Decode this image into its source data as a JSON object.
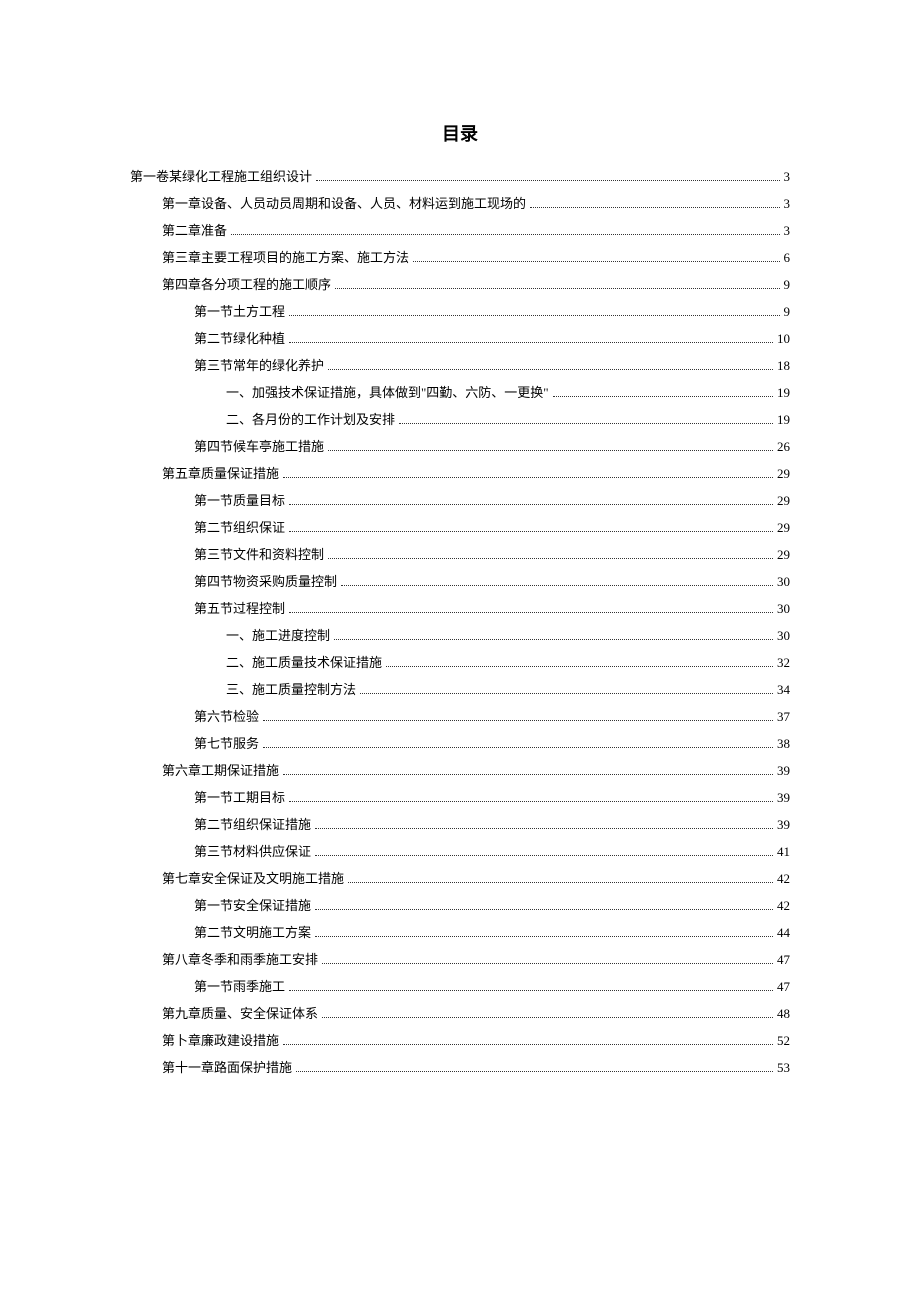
{
  "title": "目录",
  "toc": [
    {
      "level": 0,
      "text": "第一卷某绿化工程施工组织设计",
      "page": "3"
    },
    {
      "level": 1,
      "text": "第一章设备、人员动员周期和设备、人员、材料运到施工现场的",
      "page": "3"
    },
    {
      "level": 1,
      "text": "第二章准备",
      "page": "3"
    },
    {
      "level": 1,
      "text": "第三章主要工程项目的施工方案、施工方法",
      "page": "6"
    },
    {
      "level": 1,
      "text": "第四章各分项工程的施工顺序",
      "page": "9"
    },
    {
      "level": 2,
      "text": "第一节土方工程",
      "page": "9"
    },
    {
      "level": 2,
      "text": "第二节绿化种植",
      "page": "10"
    },
    {
      "level": 2,
      "text": "第三节常年的绿化养护",
      "page": "18"
    },
    {
      "level": 3,
      "text": "一、加强技术保证措施，具体做到\"四勤、六防、一更换\"",
      "page": "19"
    },
    {
      "level": 3,
      "text": "二、各月份的工作计划及安排",
      "page": "19"
    },
    {
      "level": 2,
      "text": "第四节候车亭施工措施",
      "page": "26"
    },
    {
      "level": 1,
      "text": "第五章质量保证措施",
      "page": "29"
    },
    {
      "level": 2,
      "text": "第一节质量目标",
      "page": "29"
    },
    {
      "level": 2,
      "text": "第二节组织保证",
      "page": "29"
    },
    {
      "level": 2,
      "text": "第三节文件和资料控制",
      "page": "29"
    },
    {
      "level": 2,
      "text": "第四节物资采购质量控制",
      "page": "30"
    },
    {
      "level": 2,
      "text": "第五节过程控制",
      "page": "30"
    },
    {
      "level": 3,
      "text": "一、施工进度控制",
      "page": "30"
    },
    {
      "level": 3,
      "text": "二、施工质量技术保证措施",
      "page": "32"
    },
    {
      "level": 3,
      "text": "三、施工质量控制方法",
      "page": "34"
    },
    {
      "level": 2,
      "text": "第六节检验",
      "page": "37"
    },
    {
      "level": 2,
      "text": "第七节服务",
      "page": "38"
    },
    {
      "level": 1,
      "text": "第六章工期保证措施",
      "page": "39"
    },
    {
      "level": 2,
      "text": "第一节工期目标",
      "page": "39"
    },
    {
      "level": 2,
      "text": "第二节组织保证措施",
      "page": "39"
    },
    {
      "level": 2,
      "text": "第三节材料供应保证",
      "page": "41"
    },
    {
      "level": 1,
      "text": "第七章安全保证及文明施工措施",
      "page": "42"
    },
    {
      "level": 2,
      "text": "第一节安全保证措施",
      "page": "42"
    },
    {
      "level": 2,
      "text": "第二节文明施工方案",
      "page": "44"
    },
    {
      "level": 1,
      "text": "第八章冬季和雨季施工安排",
      "page": "47"
    },
    {
      "level": 2,
      "text": "第一节雨季施工",
      "page": "47"
    },
    {
      "level": 1,
      "text": "第九章质量、安全保证体系",
      "page": "48"
    },
    {
      "level": 1,
      "text": "第卜章廉政建设措施",
      "page": "52"
    },
    {
      "level": 1,
      "text": "第十一章路面保护措施",
      "page": "53"
    }
  ]
}
